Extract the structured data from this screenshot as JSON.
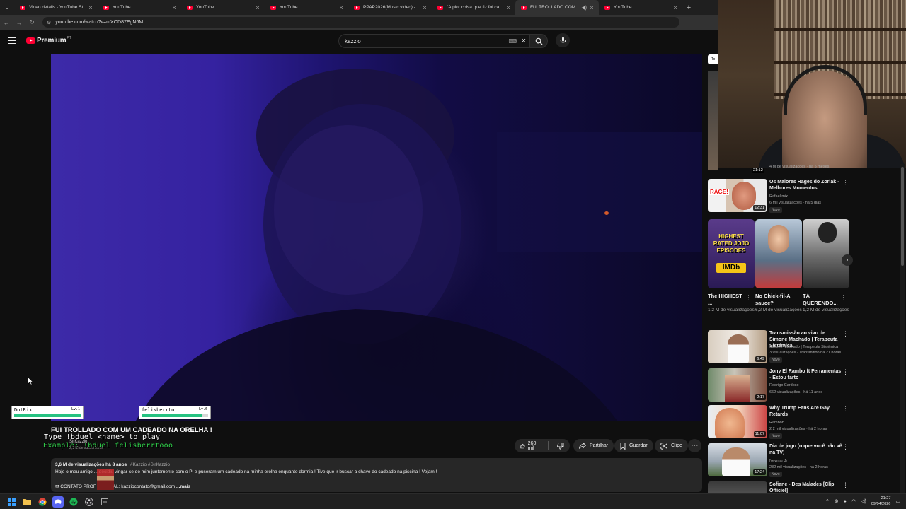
{
  "browser": {
    "tabs": [
      {
        "label": "Video details - YouTube Studio",
        "active": false
      },
      {
        "label": "YouTube",
        "active": false
      },
      {
        "label": "YouTube",
        "active": false
      },
      {
        "label": "YouTube",
        "active": false
      },
      {
        "label": "PPAP2026(Music video) - YouTube",
        "active": false
      },
      {
        "label": "\"A pior coisa que fiz foi casar\" - YouTube",
        "active": false
      },
      {
        "label": "FUI TROLLADO COM UM CADEADO",
        "active": true
      },
      {
        "label": "YouTube",
        "active": false
      }
    ],
    "url": "youtube.com/watch?v=mXOD87EgN6M"
  },
  "masthead": {
    "logo_text": "Premium",
    "country_code": "PT",
    "search_value": "kazzio"
  },
  "chip_partial": "To",
  "sidebar": {
    "top_item": {
      "duration": "21:12",
      "meta": "4 M de visualizações · há 5 meses"
    },
    "videos": [
      {
        "title": "Os Maiores Rages do Zorlak - Melhores Momentos",
        "channel": "Rafael mix",
        "meta": "6 mil visualizações · há 5 dias",
        "badge": "Novo",
        "duration": "12:31",
        "thumb_text": "RAGE!"
      },
      {
        "title": "Transmissão ao vivo de Simone Machado | Terapeuta Sistémica",
        "channel": "Simone Machado | Terapeuta Sistémica",
        "meta": "3 visualizações · Transmitido há 21 horas",
        "badge": "Novo",
        "duration": "6:49"
      },
      {
        "title": "Jony El Rambo ft Ferramentas - Estou farto",
        "channel": "Rodrigo Cardoso",
        "meta": "662 visualizações · há 11 anos",
        "badge": "",
        "duration": "2:17"
      },
      {
        "title": "Why Trump Fans Are Gay Retards",
        "channel": "Rambob",
        "meta": "2,2 mil visualizações · há 2 horas",
        "badge": "Novo",
        "duration": "11:07"
      },
      {
        "title": "Dia de jogo (o que você não vê na TV)",
        "channel": "Neymar Jr",
        "meta": "282 mil visualizações · há 2 horas",
        "badge": "Novo",
        "duration": "17:24"
      },
      {
        "title": "Sofiane - Des Malades [Clip Officiel]",
        "channel": "",
        "meta": "",
        "badge": "",
        "duration": ""
      }
    ],
    "shorts": [
      {
        "title": "The HIGHEST ...",
        "views": "1,2 M de visualizações",
        "thumb_line1": "HIGHEST",
        "thumb_line2": "RATED JOJO",
        "thumb_line3": "EPISODES",
        "thumb_logo": "IMDb"
      },
      {
        "title": "No Chick-fil-A sauce?",
        "views": "6,2 M de visualizações"
      },
      {
        "title": "TÁ QUERENDO...",
        "views": "1,2 M de visualizações"
      }
    ]
  },
  "video": {
    "title": "FUI TROLLADO COM UM CADEADO NA ORELHA !",
    "channel_name": "SirKazzio",
    "subscribers": "2,1 M de subscritores",
    "likes": "260 mil",
    "share_label": "Partilhar",
    "save_label": "Guardar",
    "clip_label": "Clipe",
    "views_meta": "3,6 M de visualizações  há 8 anos",
    "hashtags": "#Kazzio #SirKazzio",
    "desc_line1": "Hoje o meu amigo ... decidiu vingar-se de mim juntamente com o Pi e puseram um cadeado na minha orelha enquanto dormia ! Tive que ir buscar a chave do cadeado na piscina ! Vejam !",
    "desc_line2_a": "CONTATO PROF",
    "desc_line2_b": "AL: kazziocontato@gmail.com",
    "desc_more": "...mais"
  },
  "game_overlay": {
    "player1": {
      "name": "DotRix",
      "level": "Lv.1",
      "hp": 1.0
    },
    "player2": {
      "name": "felisberrto",
      "level": "Lv.6",
      "hp": 0.9
    },
    "duel_line1": "Type !bduel <name> to play",
    "duel_line2": "Example: !bduel felisberrtooo"
  },
  "taskbar": {
    "time": "21:27",
    "date": "09/04/2026"
  }
}
